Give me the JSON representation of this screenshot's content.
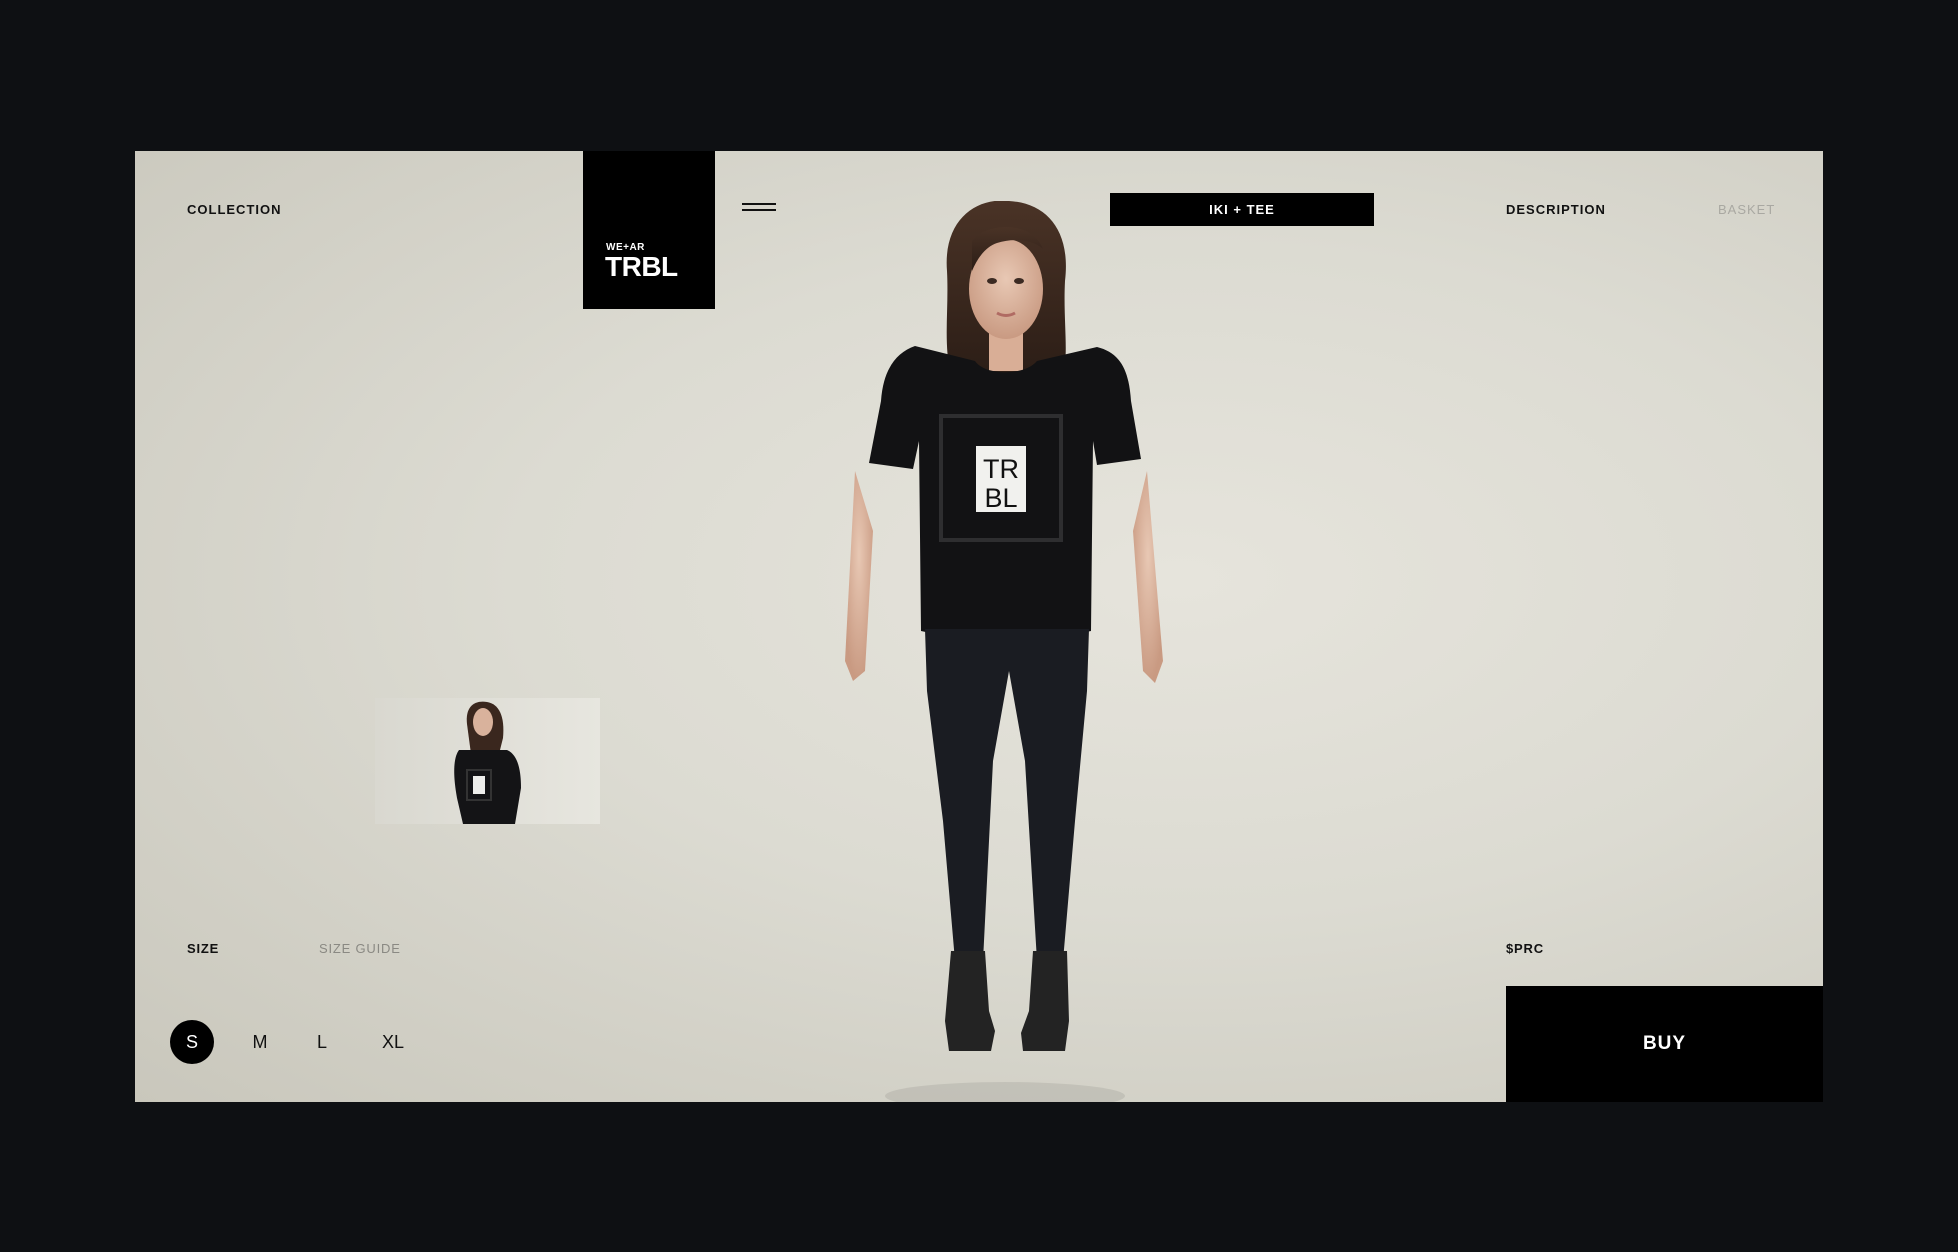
{
  "nav": {
    "collection": "COLLECTION",
    "description": "DESCRIPTION",
    "basket": "BASKET"
  },
  "logo": {
    "line1": "WE+AR",
    "line2": "TRBL"
  },
  "product": {
    "tab_label": "IKI + TEE",
    "print_line1": "TR",
    "print_line2": "BL"
  },
  "size": {
    "label": "SIZE",
    "guide": "SIZE GUIDE",
    "options": [
      "S",
      "M",
      "L",
      "XL"
    ],
    "selected": "S"
  },
  "price": "$PRC",
  "buy_label": "BUY"
}
